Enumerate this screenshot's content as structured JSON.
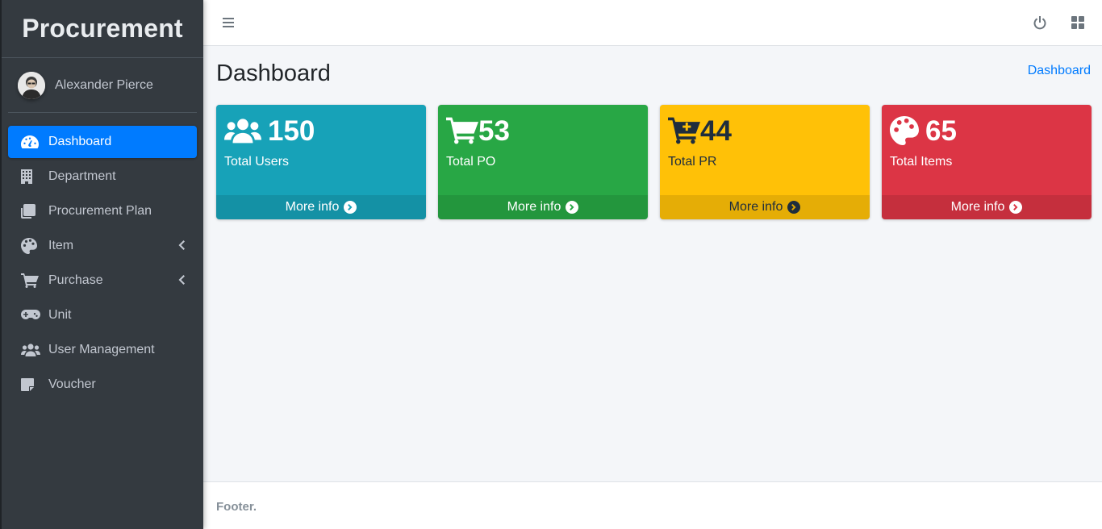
{
  "brand": {
    "title": "Procurement"
  },
  "user": {
    "name": "Alexander Pierce"
  },
  "sidebar": {
    "items": [
      {
        "label": "Dashboard",
        "icon": "tachometer-icon",
        "active": true
      },
      {
        "label": "Department",
        "icon": "building-icon"
      },
      {
        "label": "Procurement Plan",
        "icon": "copy-icon"
      },
      {
        "label": "Item",
        "icon": "palette-icon",
        "has_children": true
      },
      {
        "label": "Purchase",
        "icon": "cart-icon",
        "has_children": true
      },
      {
        "label": "Unit",
        "icon": "gamepad-icon"
      },
      {
        "label": "User Management",
        "icon": "users-icon"
      },
      {
        "label": "Voucher",
        "icon": "sticky-note-icon"
      }
    ]
  },
  "header": {
    "menu_icon": "hamburger-icon",
    "power_icon": "power-icon",
    "grid_icon": "grid-icon"
  },
  "page": {
    "title": "Dashboard",
    "breadcrumb": "Dashboard"
  },
  "stats": [
    {
      "value": "150",
      "label": "Total Users",
      "link": "More info",
      "icon": "users-icon",
      "color": "#17a2b8"
    },
    {
      "value": "53",
      "label": "Total PO",
      "link": "More info",
      "icon": "cart-icon",
      "color": "#28a745"
    },
    {
      "value": "44",
      "label": "Total PR",
      "link": "More info",
      "icon": "cart-plus-icon",
      "color": "#ffc107"
    },
    {
      "value": "65",
      "label": "Total Items",
      "link": "More info",
      "icon": "palette-icon",
      "color": "#dc3545"
    }
  ],
  "footer": {
    "text": "Footer."
  },
  "colors": {
    "sidebar": "#343a40",
    "primary": "#007bff",
    "content_bg": "#f4f6f9"
  }
}
